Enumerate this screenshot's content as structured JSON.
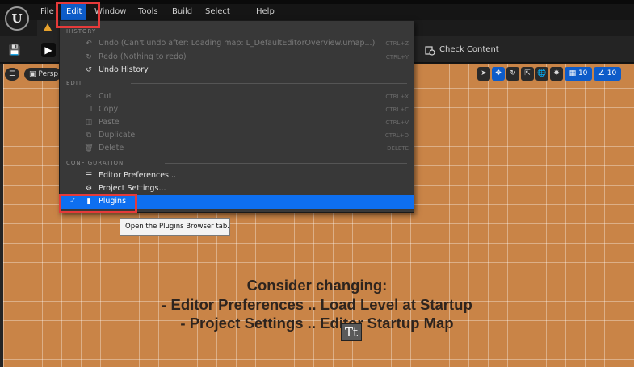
{
  "menubar": {
    "items": [
      "File",
      "Edit",
      "Window",
      "Tools",
      "Build",
      "Select",
      "Help"
    ],
    "active": "Edit"
  },
  "toolbar": {
    "check_content_label": "Check Content"
  },
  "viewport": {
    "perspective_label": "Persp",
    "grid_size": "10",
    "angle_snap": "10",
    "message_line1": "Consider changing:",
    "message_line2": "- Editor Preferences .. Load Level at Startup",
    "message_line3": "- Project Settings .. Editor Startup Map"
  },
  "edit_menu": {
    "history_heading": "HISTORY",
    "edit_heading": "EDIT",
    "configuration_heading": "CONFIGURATION",
    "history_items": [
      {
        "label": "Undo (Can't undo after: Loading map: L_DefaultEditorOverview.umap...)",
        "shortcut": "CTRL+Z",
        "icon": "undo-icon"
      },
      {
        "label": "Redo (Nothing to redo)",
        "shortcut": "CTRL+Y",
        "icon": "redo-icon"
      },
      {
        "label": "Undo History",
        "shortcut": "",
        "icon": "undo-history-icon"
      }
    ],
    "edit_items": [
      {
        "label": "Cut",
        "shortcut": "CTRL+X",
        "icon": "cut-icon"
      },
      {
        "label": "Copy",
        "shortcut": "CTRL+C",
        "icon": "copy-icon"
      },
      {
        "label": "Paste",
        "shortcut": "CTRL+V",
        "icon": "paste-icon"
      },
      {
        "label": "Duplicate",
        "shortcut": "CTRL+D",
        "icon": "duplicate-icon"
      },
      {
        "label": "Delete",
        "shortcut": "DELETE",
        "icon": "delete-icon"
      }
    ],
    "config_items": [
      {
        "label": "Editor Preferences...",
        "icon": "sliders-icon"
      },
      {
        "label": "Project Settings...",
        "icon": "gear-icon"
      },
      {
        "label": "Plugins",
        "icon": "plug-icon"
      }
    ]
  },
  "tooltip": {
    "text": "Open the Plugins Browser tab."
  },
  "colors": {
    "accent": "#0e6ff0",
    "highlight_box": "#e53a3a",
    "viewport_floor": "#c98447"
  }
}
